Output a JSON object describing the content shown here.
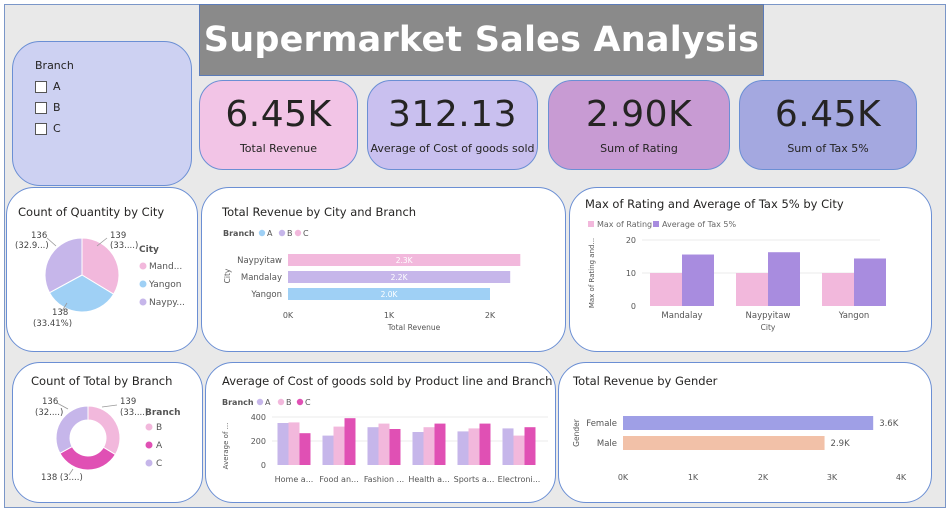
{
  "title": "Supermarket Sales Analysis",
  "slicer": {
    "title": "Branch",
    "options": [
      "A",
      "B",
      "C"
    ]
  },
  "kpis": [
    {
      "value": "6.45K",
      "label": "Total Revenue",
      "color": "#f2c4e6"
    },
    {
      "value": "312.13",
      "label": "Average of Cost of goods sold",
      "color": "#c9c0ef"
    },
    {
      "value": "2.90K",
      "label": "Sum of Rating",
      "color": "#c89bd3"
    },
    {
      "value": "6.45K",
      "label": "Sum of Tax 5%",
      "color": "#a4a8e0"
    }
  ],
  "pie_city": {
    "title": "Count of Quantity by City",
    "legend_title": "City",
    "legend": [
      "Mand...",
      "Yangon",
      "Naypy..."
    ],
    "labels": {
      "a1": "139",
      "a2": "(33....)",
      "b1": "136",
      "b2": "(32.9...)",
      "c1": "138",
      "c2": "(33.41%)"
    }
  },
  "bar_city": {
    "title": "Total Revenue by City and Branch",
    "legend_title": "Branch",
    "legend": [
      "A",
      "B",
      "C"
    ],
    "y_title": "City",
    "x_title": "Total Revenue",
    "ticks": [
      "0K",
      "1K",
      "2K"
    ],
    "bars": [
      {
        "name": "Naypyitaw",
        "label": "2.3K"
      },
      {
        "name": "Mandalay",
        "label": "2.2K"
      },
      {
        "name": "Yangon",
        "label": "2.0K"
      }
    ]
  },
  "col_rating": {
    "title": "Max of Rating and Average of Tax 5% by City",
    "legend": [
      "Max of Rating",
      "Average of Tax 5%"
    ],
    "y_title": "Max of Rating and...",
    "x_title": "City",
    "ticks": [
      "0",
      "10",
      "20"
    ],
    "categories": [
      "Mandalay",
      "Naypyitaw",
      "Yangon"
    ]
  },
  "donut_branch": {
    "title": "Count of Total by Branch",
    "legend_title": "Branch",
    "legend": [
      "B",
      "A",
      "C"
    ],
    "labels": {
      "a1": "139",
      "a2": "(33....)",
      "b1": "136",
      "b2": "(32....)",
      "c1": "138 (3....)"
    }
  },
  "col_product": {
    "title": "Average of Cost of goods sold by Product line and Branch",
    "legend_title": "Branch",
    "legend": [
      "A",
      "B",
      "C"
    ],
    "y_title": "Average of ...",
    "ticks": [
      "0",
      "200",
      "400"
    ],
    "categories": [
      "Home a...",
      "Food an...",
      "Fashion ...",
      "Health a...",
      "Sports a...",
      "Electroni..."
    ]
  },
  "bar_gender": {
    "title": "Total Revenue by Gender",
    "y_title": "Gender",
    "ticks": [
      "0K",
      "1K",
      "2K",
      "3K",
      "4K"
    ],
    "bars": [
      {
        "name": "Female",
        "label": "3.6K"
      },
      {
        "name": "Male",
        "label": "2.9K"
      }
    ]
  },
  "colors": {
    "pink": "#f2b8dc",
    "lightblue": "#9fd0f5",
    "lavender": "#c6b6ea",
    "purple": "#a88cdf",
    "magenta": "#e050b4",
    "salmon": "#f2c1a8",
    "periwinkle": "#9f9fe6"
  },
  "chart_data": [
    {
      "type": "pie",
      "title": "Count of Quantity by City",
      "categories": [
        "Mandalay",
        "Yangon",
        "Naypyitaw"
      ],
      "values": [
        139,
        138,
        136
      ],
      "legend": "right"
    },
    {
      "type": "bar",
      "title": "Total Revenue by City and Branch",
      "categories": [
        "Naypyitaw",
        "Mandalay",
        "Yangon"
      ],
      "values": [
        2300,
        2200,
        2000
      ],
      "xlabel": "Total Revenue",
      "ylabel": "City",
      "xlim": [
        0,
        2400
      ]
    },
    {
      "type": "bar",
      "title": "Max of Rating and Average of Tax 5% by City",
      "categories": [
        "Mandalay",
        "Naypyitaw",
        "Yangon"
      ],
      "series": [
        {
          "name": "Max of Rating",
          "values": [
            10,
            10,
            10
          ]
        },
        {
          "name": "Average of Tax 5%",
          "values": [
            15.6,
            16.3,
            14.4
          ]
        }
      ],
      "xlabel": "City",
      "ylim": [
        0,
        20
      ]
    },
    {
      "type": "pie",
      "title": "Count of Total by Branch",
      "categories": [
        "B",
        "A",
        "C"
      ],
      "values": [
        139,
        138,
        136
      ],
      "legend": "right"
    },
    {
      "type": "bar",
      "title": "Average of Cost of goods sold by Product line and Branch",
      "categories": [
        "Home a...",
        "Food an...",
        "Fashion ...",
        "Health a...",
        "Sports a...",
        "Electroni..."
      ],
      "series": [
        {
          "name": "A",
          "values": [
            350,
            245,
            315,
            275,
            280,
            305
          ]
        },
        {
          "name": "B",
          "values": [
            355,
            320,
            345,
            315,
            305,
            245
          ]
        },
        {
          "name": "C",
          "values": [
            265,
            390,
            300,
            345,
            345,
            315
          ]
        }
      ],
      "ylim": [
        0,
        450
      ]
    },
    {
      "type": "bar",
      "title": "Total Revenue by Gender",
      "categories": [
        "Female",
        "Male"
      ],
      "values": [
        3600,
        2900
      ],
      "ylabel": "Gender",
      "xlim": [
        0,
        4000
      ]
    }
  ]
}
